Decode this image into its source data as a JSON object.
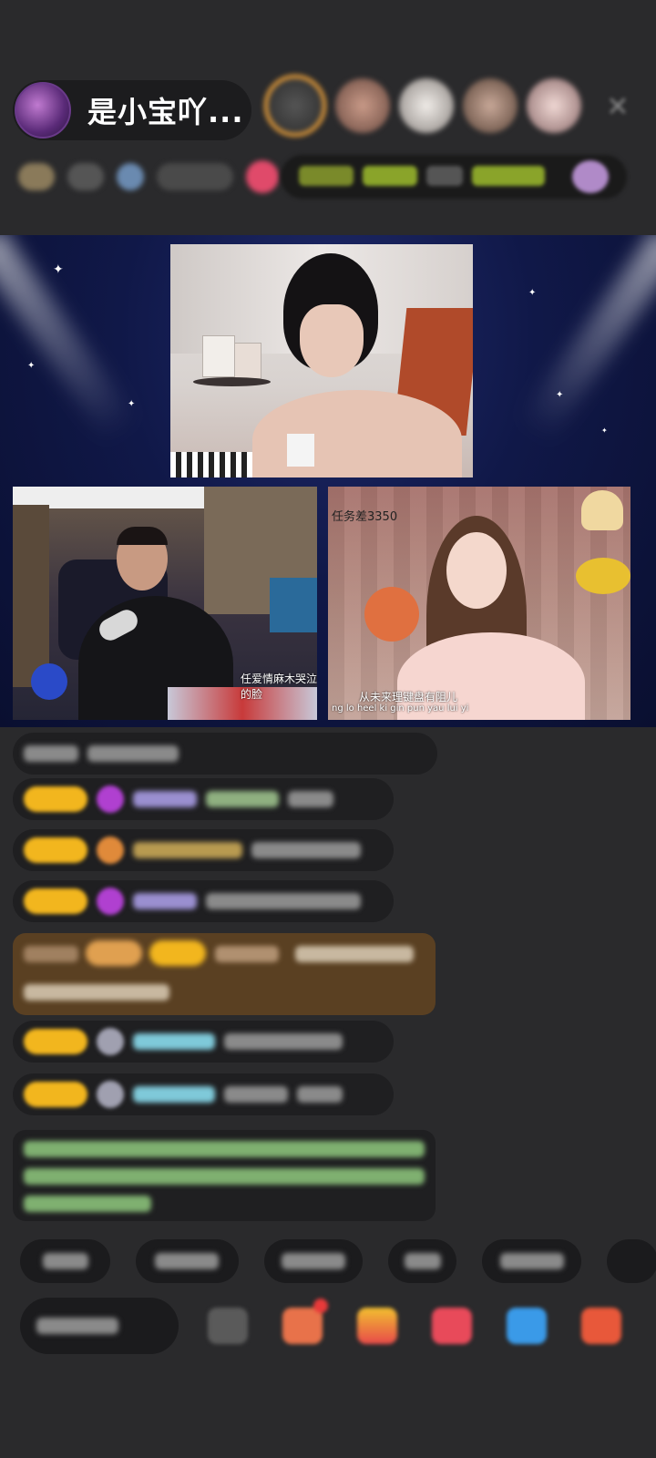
{
  "header": {
    "host_name": "是小宝吖...",
    "icons": {
      "avatar": "host-avatar",
      "close": "close-icon"
    },
    "viewer_colors": [
      "#b88a78",
      "#e0d6d0",
      "#b49684",
      "#e2c8c4"
    ]
  },
  "stage": {
    "right_cam_label": "任务差3350",
    "left_subtitle_1": "任爱情麻木哭泣的脸",
    "right_subtitle_1": "从未来理键盘有阻儿",
    "right_subtitle_2": "ng lo heel ki gin pun yau lui yi"
  },
  "chat": {
    "level_color": "#f2b61e",
    "gift_card_color": "#5a4022",
    "name_colors": [
      "#9a8fd0",
      "#d9b860",
      "#7fc9d9",
      "#8fd080"
    ]
  },
  "bottom": {
    "quick_replies_count_visible": 6,
    "icons": [
      "chat-icon",
      "gift-box-icon",
      "gift-bag-icon",
      "red-packet-icon",
      "game-icon",
      "more-icon"
    ]
  }
}
